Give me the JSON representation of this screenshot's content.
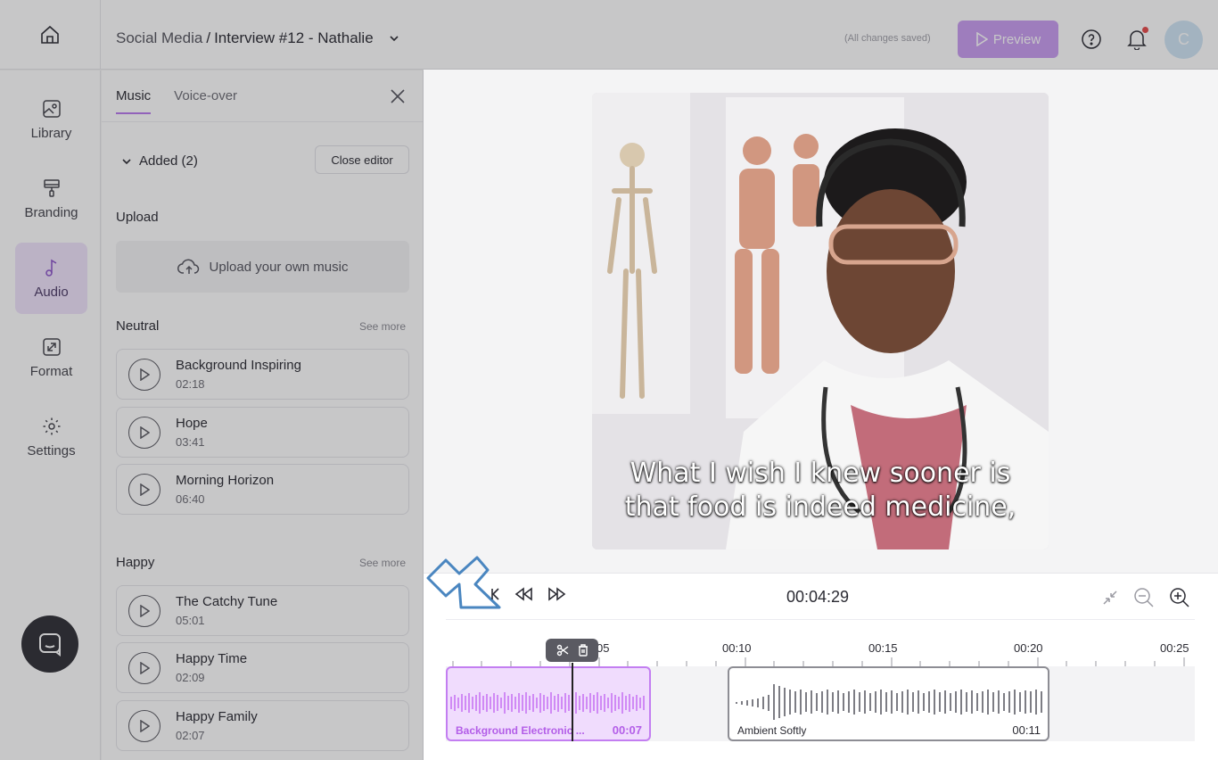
{
  "topbar": {
    "breadcrumb_root": "Social Media",
    "breadcrumb_sep": "/",
    "breadcrumb_project": "Interview #12 - Nathalie",
    "save_status": "(All changes saved)",
    "preview_label": "Preview",
    "avatar_initial": "C",
    "accent_color": "#c89cf0"
  },
  "rail": {
    "items": [
      {
        "label": "Library",
        "icon": "image-icon"
      },
      {
        "label": "Branding",
        "icon": "paint-roller-icon"
      },
      {
        "label": "Audio",
        "icon": "music-note-icon",
        "active": true
      },
      {
        "label": "Format",
        "icon": "resize-icon"
      },
      {
        "label": "Settings",
        "icon": "gear-icon"
      }
    ]
  },
  "panel": {
    "tabs": [
      "Music",
      "Voice-over"
    ],
    "active_tab": "Music",
    "added_label": "Added (2)",
    "close_editor_label": "Close editor",
    "upload_title": "Upload",
    "upload_label": "Upload your own music",
    "sections": [
      {
        "title": "Neutral",
        "see_more": "See more",
        "tracks": [
          {
            "name": "Background Inspiring",
            "duration": "02:18"
          },
          {
            "name": "Hope",
            "duration": "03:41"
          },
          {
            "name": "Morning Horizon",
            "duration": "06:40"
          }
        ]
      },
      {
        "title": "Happy",
        "see_more": "See more",
        "tracks": [
          {
            "name": "The Catchy Tune",
            "duration": "05:01"
          },
          {
            "name": "Happy Time",
            "duration": "02:09"
          },
          {
            "name": "Happy Family",
            "duration": "02:07"
          }
        ]
      }
    ]
  },
  "video": {
    "caption_line1": "What I wish I knew sooner is",
    "caption_line2": "that food is indeed medicine,"
  },
  "timeline": {
    "timecode": "00:04:29",
    "ruler": [
      "05",
      "00:10",
      "00:15",
      "00:20",
      "00:25"
    ],
    "clips": [
      {
        "name": "Background Electronic ...",
        "duration": "00:07",
        "color": "#c37ef1"
      },
      {
        "name": "Ambient Softly",
        "duration": "00:11",
        "color": "#8d8d94"
      }
    ]
  }
}
